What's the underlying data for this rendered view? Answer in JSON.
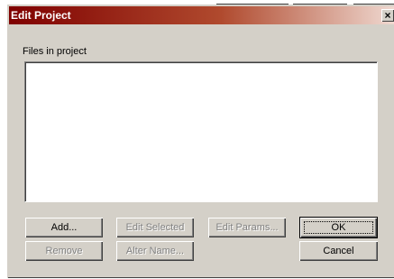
{
  "window": {
    "title": "Edit Project",
    "close_glyph": "×"
  },
  "files_label": "Files in project",
  "buttons": {
    "add": "Add...",
    "edit_selected": "Edit Selected",
    "edit_params": "Edit Params...",
    "ok": "OK",
    "remove": "Remove",
    "alter_name": "Alter Name...",
    "cancel": "Cancel"
  },
  "button_states": {
    "add": "enabled",
    "edit_selected": "disabled",
    "edit_params": "disabled",
    "ok": "default",
    "remove": "disabled",
    "alter_name": "disabled",
    "cancel": "enabled"
  },
  "icons": {
    "close": "close-icon"
  },
  "colors": {
    "titlebar_start": "#7f0000",
    "titlebar_end": "#efd8d0",
    "face": "#d4d0c8",
    "list_background": "#ffffff"
  }
}
